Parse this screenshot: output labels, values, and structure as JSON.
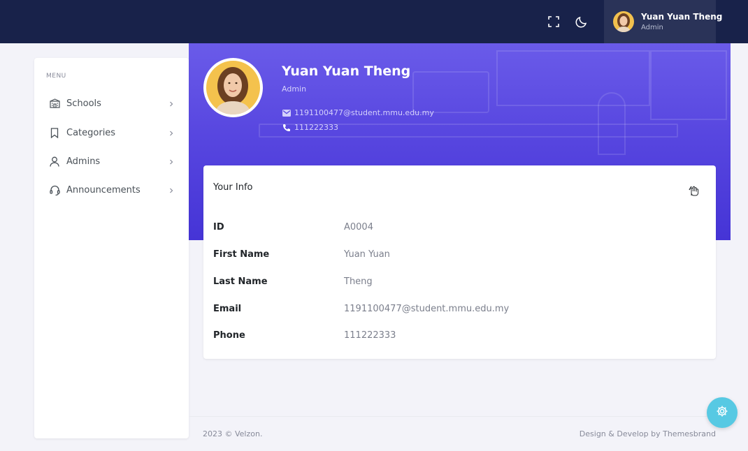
{
  "topbar": {
    "fullscreen_icon": "fullscreen-icon",
    "theme_icon": "moon-icon",
    "user": {
      "name": "Yuan Yuan Theng",
      "role": "Admin"
    }
  },
  "sidebar": {
    "menu_title": "MENU",
    "items": [
      {
        "label": "Schools",
        "icon": "school-icon"
      },
      {
        "label": "Categories",
        "icon": "bookmark-icon"
      },
      {
        "label": "Admins",
        "icon": "user-icon"
      },
      {
        "label": "Announcements",
        "icon": "headset-icon"
      }
    ]
  },
  "profile": {
    "name": "Yuan Yuan Theng",
    "role": "Admin",
    "email": "1191100477@student.mmu.edu.my",
    "phone": "111222333"
  },
  "info_card": {
    "title": "Your Info",
    "edit_icon": "edit-icon",
    "rows": [
      {
        "label": "ID",
        "value": "A0004"
      },
      {
        "label": "First Name",
        "value": "Yuan Yuan"
      },
      {
        "label": "Last Name",
        "value": "Theng"
      },
      {
        "label": "Email",
        "value": "1191100477@student.mmu.edu.my"
      },
      {
        "label": "Phone",
        "value": "111222333"
      }
    ]
  },
  "footer": {
    "copyright": "2023 © Velzon.",
    "credit": "Design & Develop by Themesbrand"
  },
  "colors": {
    "topbar": "#18224a",
    "banner": "#5847e0",
    "fab": "#57c9e3"
  }
}
